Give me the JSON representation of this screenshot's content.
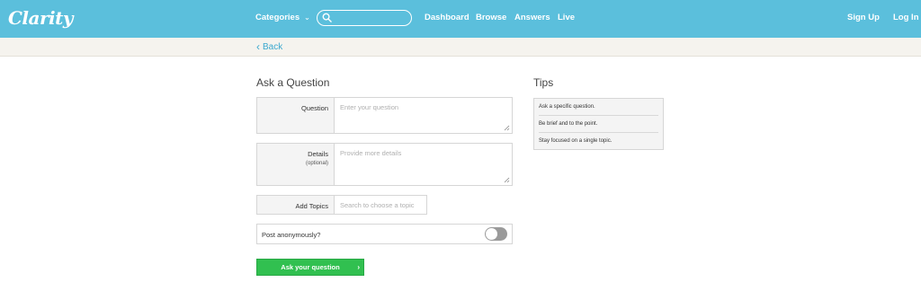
{
  "header": {
    "logo": "Clarity",
    "categories_label": "Categories",
    "search_placeholder": "",
    "nav": [
      "Dashboard",
      "Browse",
      "Answers",
      "Live"
    ],
    "signup": "Sign Up",
    "login": "Log In"
  },
  "subbar": {
    "back_label": "Back"
  },
  "form": {
    "title": "Ask a Question",
    "question_label": "Question",
    "question_placeholder": "Enter your question",
    "details_label": "Details",
    "details_optional": "(optional)",
    "details_placeholder": "Provide more details",
    "topics_label": "Add Topics",
    "topics_placeholder": "Search to choose a topic",
    "anon_label": "Post anonymously?",
    "anon_on": false,
    "submit_label": "Ask your question"
  },
  "tips": {
    "title": "Tips",
    "items": [
      "Ask a specific question.",
      "Be brief and to the point.",
      "Stay focused on a single topic."
    ]
  },
  "colors": {
    "header_bg": "#5bbfdc",
    "link": "#3ba8cf",
    "submit": "#31c050"
  }
}
